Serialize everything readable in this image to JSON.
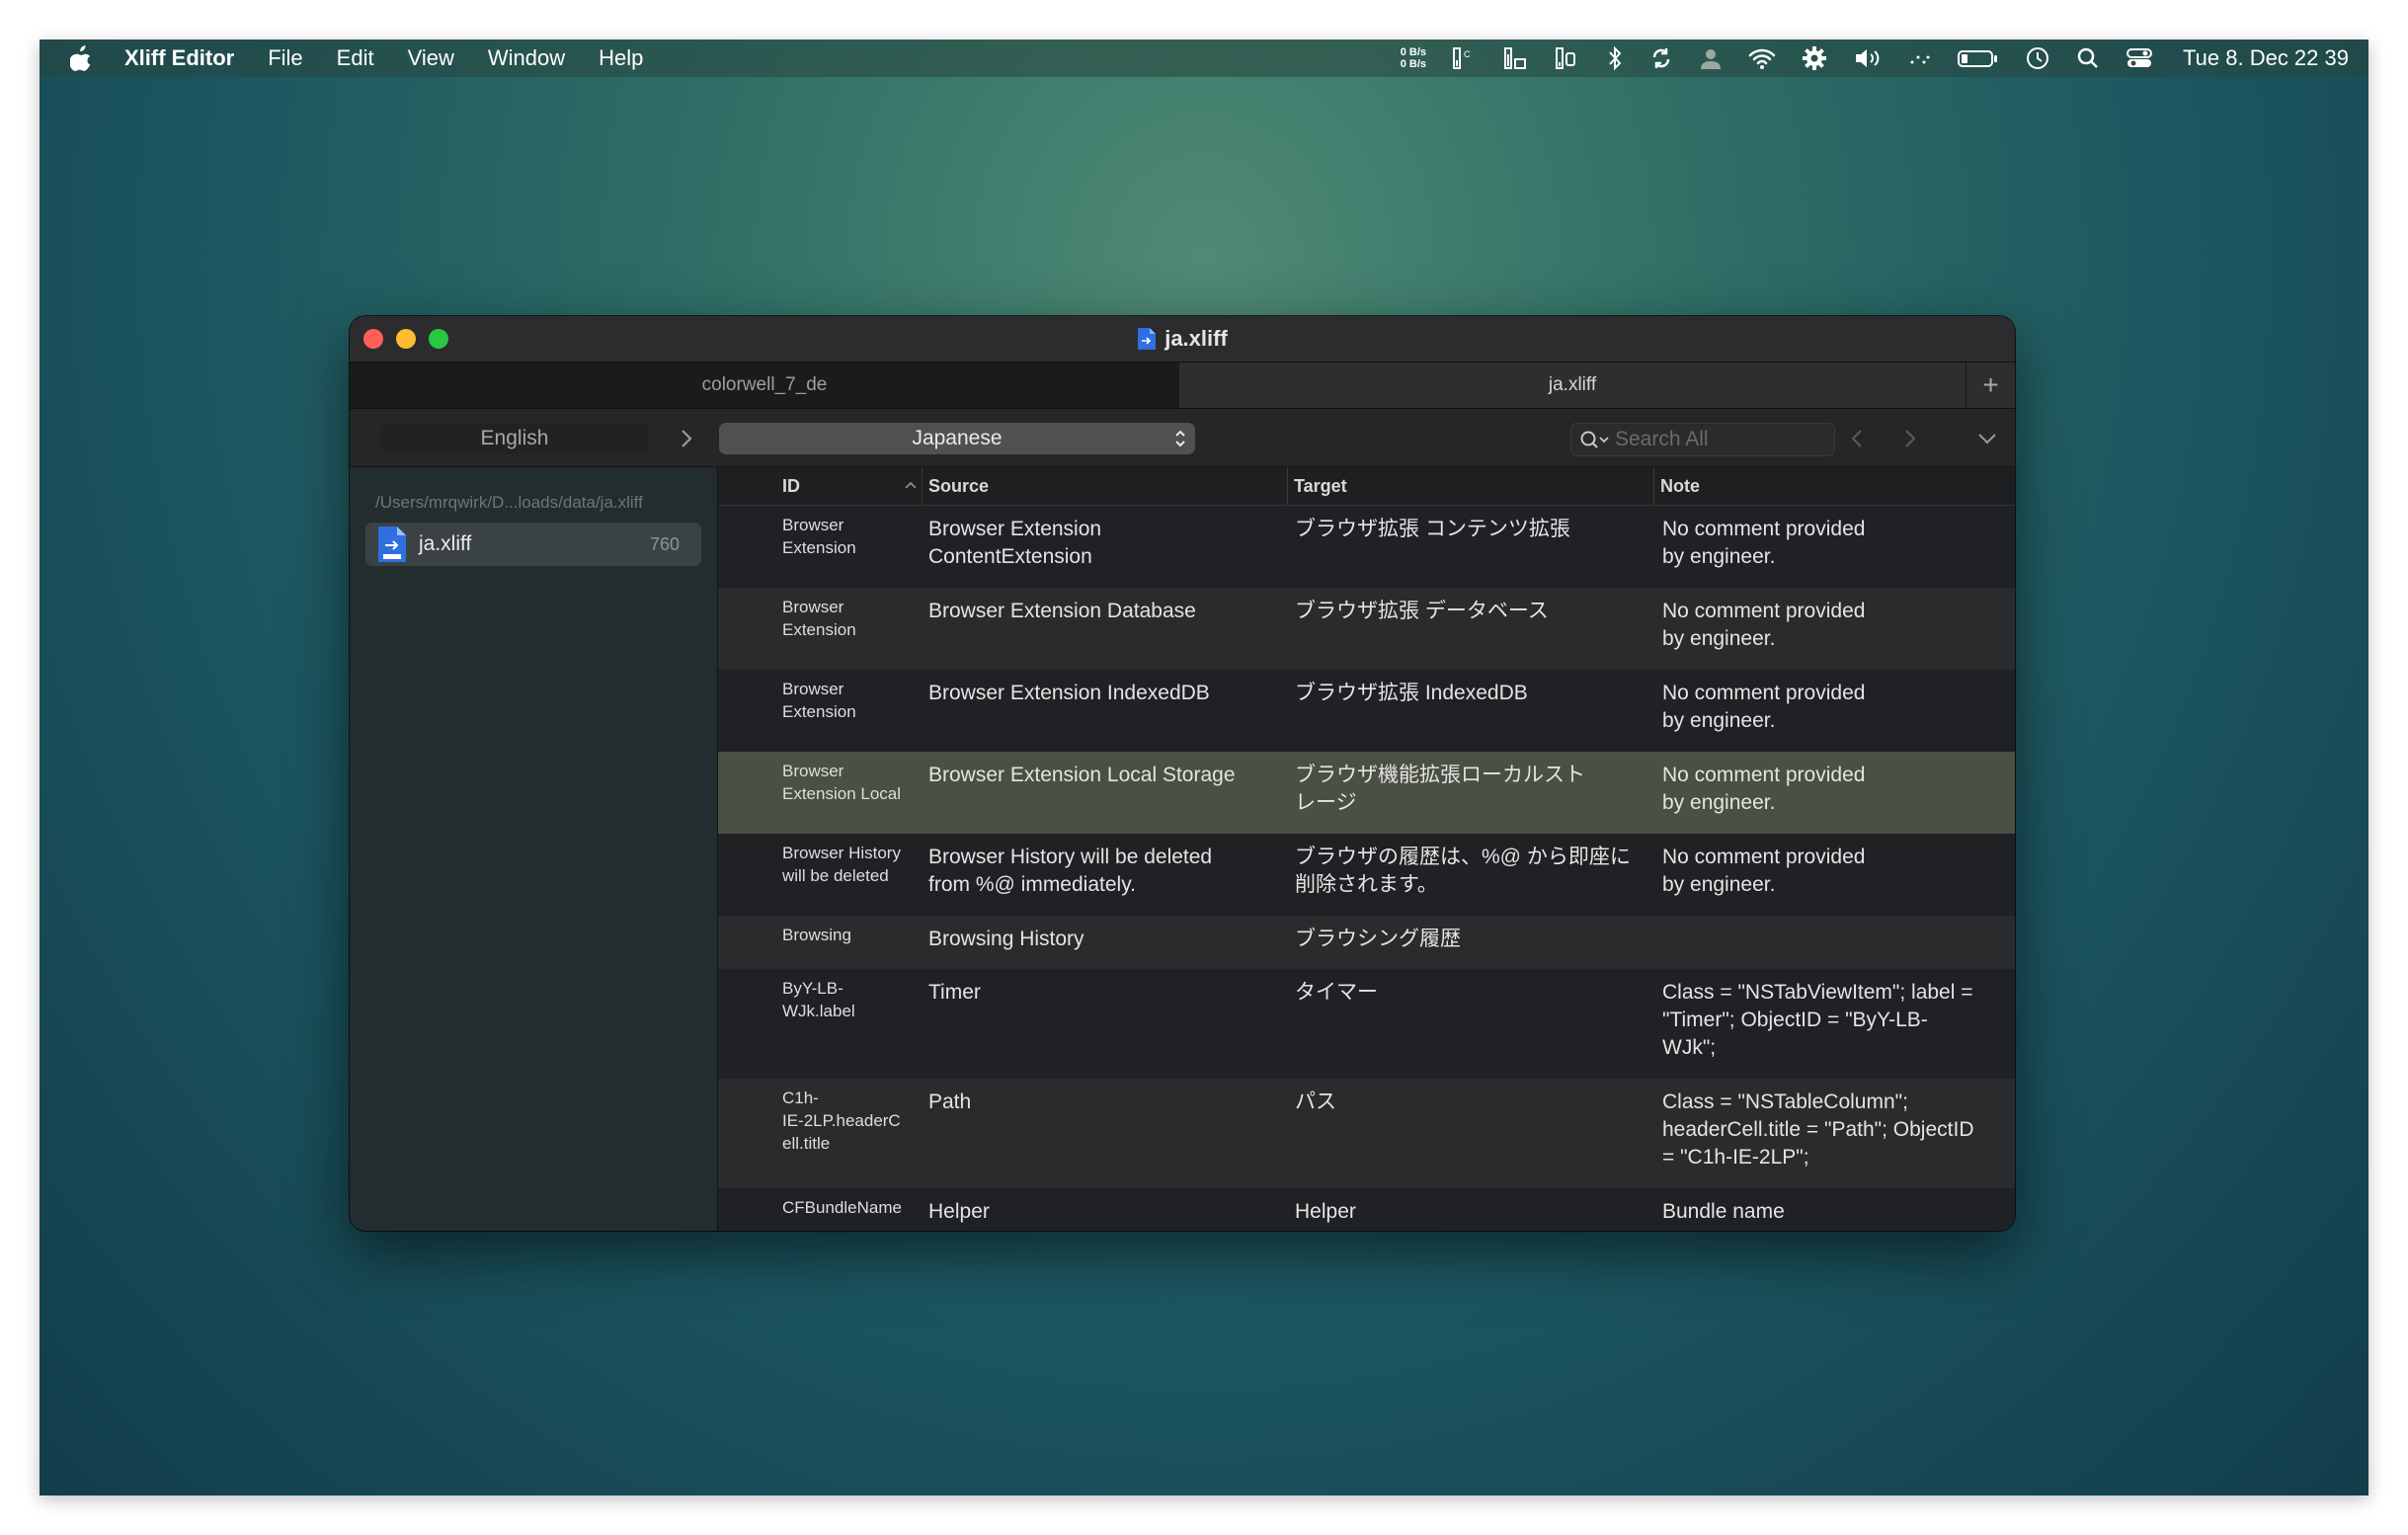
{
  "menubar": {
    "app_name": "Xliff Editor",
    "menus": [
      "File",
      "Edit",
      "View",
      "Window",
      "Help"
    ],
    "net_up": "0 B/s",
    "net_down": "0 B/s",
    "clock": "Tue 8. Dec  22 39",
    "status_icons": [
      "cpu-meter-icon",
      "memory-meter-icon",
      "disk-meter-icon",
      "bluetooth-icon",
      "sync-icon",
      "user-icon",
      "wifi-icon",
      "gear-icon",
      "volume-icon",
      "dots-icon",
      "battery-icon",
      "time-machine-icon",
      "spotlight-icon",
      "control-center-icon"
    ]
  },
  "window": {
    "title": "ja.xliff",
    "tabs": [
      {
        "label": "colorwell_7_de",
        "active": false
      },
      {
        "label": "ja.xliff",
        "active": true
      }
    ],
    "add_tab_label": "+"
  },
  "toolbar": {
    "source_language": "English",
    "target_language": "Japanese",
    "search_placeholder": "Search All"
  },
  "sidebar": {
    "path": "/Users/mrqwirk/D...loads/data/ja.xliff",
    "file": {
      "name": "ja.xliff",
      "count": "760"
    }
  },
  "table": {
    "headers": {
      "id": "ID",
      "source": "Source",
      "target": "Target",
      "note": "Note"
    },
    "rows": [
      {
        "id": "Browser\nExtension",
        "source": "Browser Extension\nContentExtension",
        "target": "ブラウザ拡張 コンテンツ拡張",
        "note": "No comment provided\nby engineer.",
        "selected": false
      },
      {
        "id": "Browser\nExtension",
        "source": "Browser Extension Database",
        "target": "ブラウザ拡張 データベース",
        "note": "No comment provided\nby engineer.",
        "selected": false
      },
      {
        "id": "Browser\nExtension",
        "source": "Browser Extension IndexedDB",
        "target": "ブラウザ拡張 IndexedDB",
        "note": "No comment provided\nby engineer.",
        "selected": false
      },
      {
        "id": "Browser\nExtension Local",
        "source": "Browser Extension Local Storage",
        "target": "ブラウザ機能拡張ローカルスト\nレージ",
        "note": "No comment provided\nby engineer.",
        "selected": true
      },
      {
        "id": "Browser History\nwill be deleted",
        "source": "Browser History will be deleted\nfrom %@ immediately.",
        "target": "ブラウザの履歴は、%@ から即座に\n削除されます。",
        "note": "No comment provided\nby engineer.",
        "selected": false
      },
      {
        "id": "Browsing",
        "source": "Browsing History",
        "target": "ブラウシング履歴",
        "note": "",
        "selected": false
      },
      {
        "id": "ByY-LB-\nWJk.label",
        "source": "Timer",
        "target": "タイマー",
        "note": "Class = \"NSTabViewItem\"; label =\n\"Timer\"; ObjectID = \"ByY-LB-\nWJk\";",
        "selected": false
      },
      {
        "id": "C1h-\nIE-2LP.headerC\nell.title",
        "source": "Path",
        "target": "パス",
        "note": "Class = \"NSTableColumn\";\nheaderCell.title = \"Path\"; ObjectID\n= \"C1h-IE-2LP\";",
        "selected": false
      },
      {
        "id": "CFBundleName",
        "source": "Helper",
        "target": "Helper",
        "note": "Bundle name",
        "selected": false
      }
    ]
  }
}
